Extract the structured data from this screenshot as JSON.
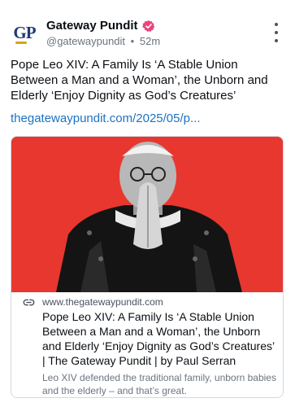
{
  "author": {
    "avatar_text": "GP",
    "display_name": "Gateway Pundit",
    "handle": "@gatewaypundit",
    "separator": "•",
    "time_ago": "52m",
    "verified_color": "#e8457a"
  },
  "post": {
    "text": "Pope Leo XIV: A Family Is ‘A Stable Union Between a Man and a Woman’, the Unborn and Elderly ‘Enjoy Dignity as God’s Creatures’",
    "link_text": "thegatewaypundit.com/2025/05/p..."
  },
  "card": {
    "image_background": "#e8372f",
    "image_description_icon": "photo",
    "domain": "www.thegatewaypundit.com",
    "title": "Pope Leo XIV: A Family Is ‘A Stable Union Between a Man and a Woman’, the Unborn and Elderly ‘Enjoy Dignity as God’s Creatures’ | The Gateway Pundit | by Paul Serran",
    "description": "Leo XIV defended the traditional family, unborn babies and the elderly – and that’s great."
  },
  "colors": {
    "link": "#1d72c2",
    "muted": "#6b7480",
    "accent": "#e8372f"
  }
}
